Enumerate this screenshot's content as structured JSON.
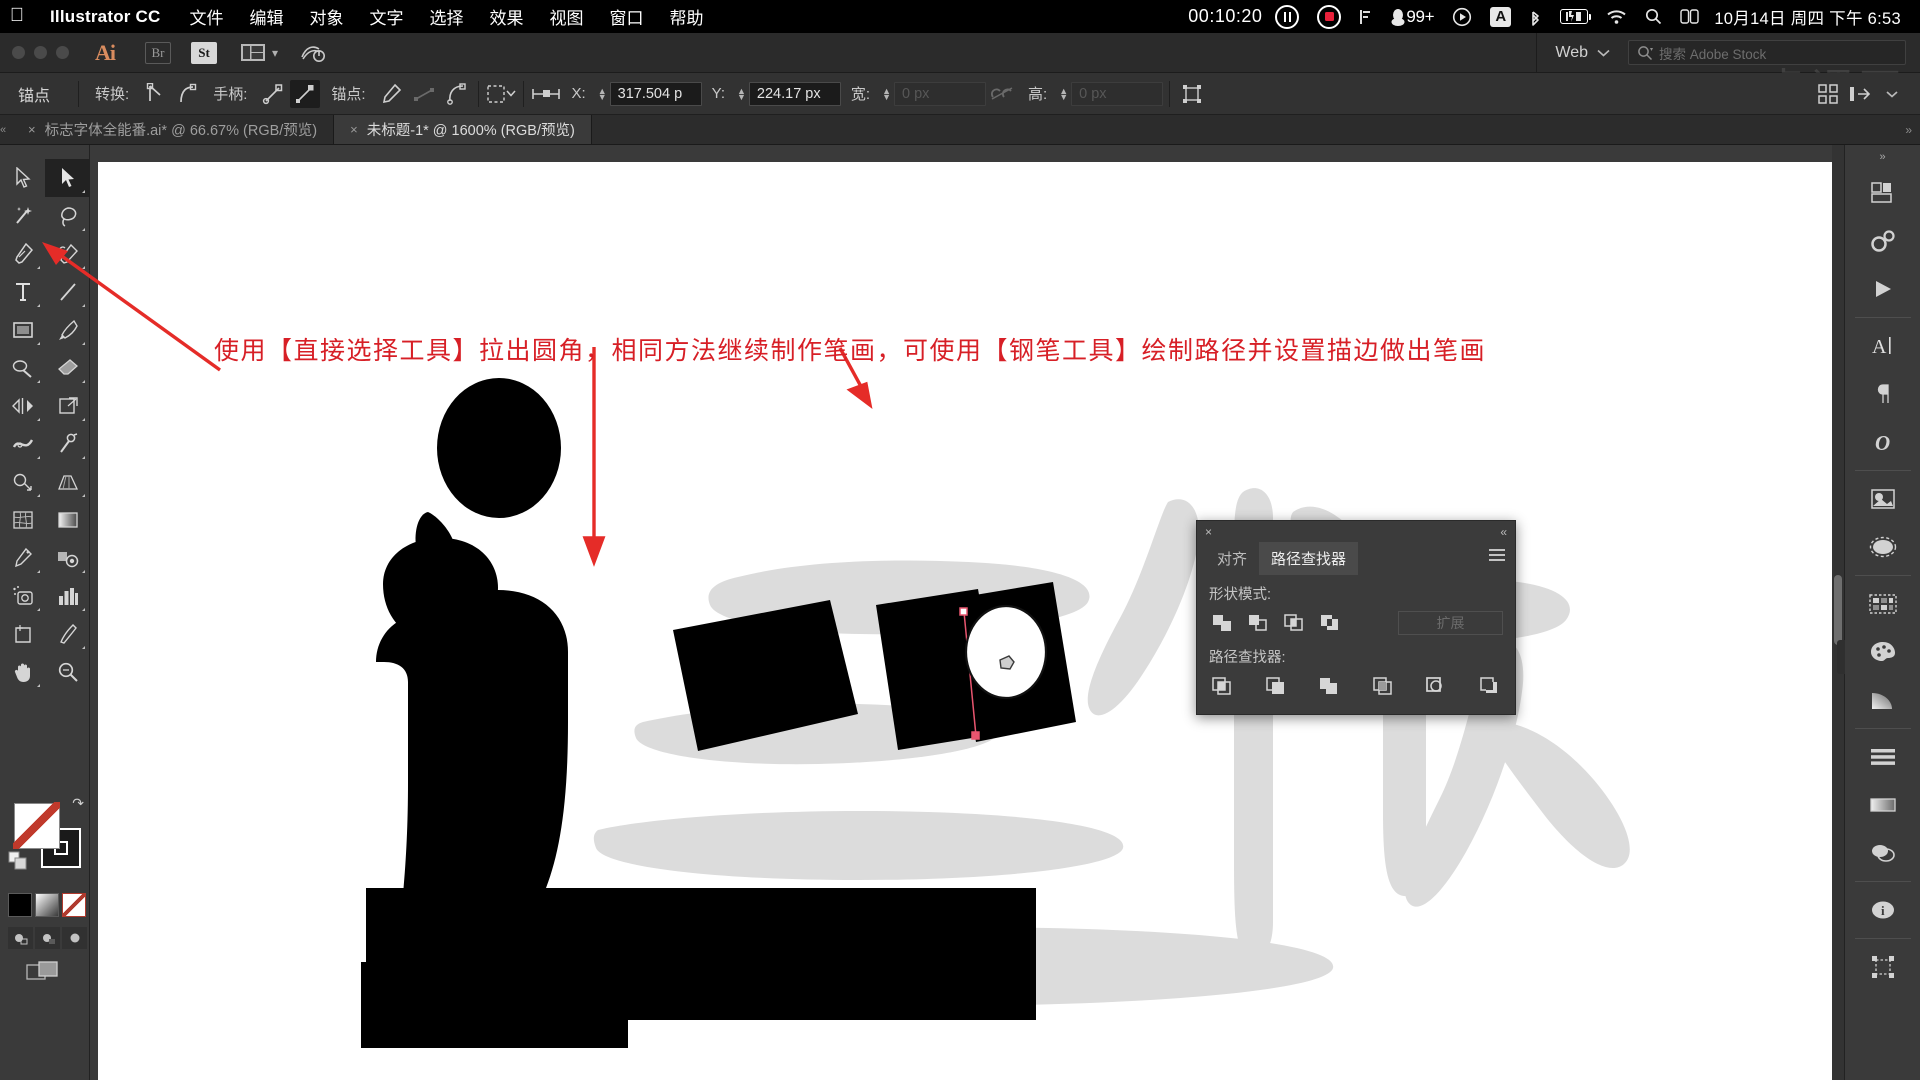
{
  "mac_menu": {
    "apple_icon": "apple-icon",
    "app_name": "Illustrator CC",
    "items": [
      "文件",
      "编辑",
      "对象",
      "文字",
      "选择",
      "效果",
      "视图",
      "窗口",
      "帮助"
    ],
    "recording_time": "00:10:20",
    "notification_badge": "99+",
    "input_source": "A",
    "datetime": "10月14日 周四 下午 6:53",
    "status_icons": [
      "pause-icon",
      "record-icon",
      "signal-icon",
      "penguin-icon",
      "play-circle-icon",
      "input-source-icon",
      "bluetooth-icon",
      "battery-icon",
      "wifi-icon",
      "search-icon",
      "control-center-icon"
    ]
  },
  "appbar": {
    "logo": "Ai",
    "buttons": [
      {
        "label": "Br",
        "name": "bridge-button",
        "active": false
      },
      {
        "label": "St",
        "name": "stock-button",
        "active": true
      }
    ],
    "arrange_icon": "arrange-documents-icon",
    "chevron": "▾",
    "sync_icon": "sync-settings-icon",
    "workspace": "Web",
    "search_placeholder": "搜索 Adobe Stock",
    "watermark": "虎课网"
  },
  "control_bar": {
    "title": "锚点",
    "convert_label": "转换:",
    "handles_label": "手柄:",
    "anchor_label": "锚点:",
    "x_label": "X:",
    "x_value": "317.504 p",
    "y_label": "Y:",
    "y_value": "224.17 px",
    "w_label": "宽:",
    "w_value": "0 px",
    "h_label": "高:",
    "h_value": "0 px",
    "link_icon": "unlink-icon",
    "align_icon": "align-icon",
    "icons": [
      "convert-corner-icon",
      "convert-smooth-icon",
      "handle-show-icon",
      "handle-hide-icon",
      "anchor-remove-icon",
      "anchor-connect-icon",
      "anchor-cut-icon",
      "isolate-icon",
      "transform-icon"
    ],
    "right_icons": [
      "grid-view-icon",
      "arrange-icon",
      "more-icon"
    ]
  },
  "tabs": [
    {
      "label": "标志字体全能番.ai* @ 66.67% (RGB/预览)",
      "active": false,
      "close": "×"
    },
    {
      "label": "未标题-1* @ 1600% (RGB/预览)",
      "active": true,
      "close": "×"
    }
  ],
  "toolbar": {
    "tools": [
      {
        "name": "selection-tool",
        "icon": "selection-arrow-icon",
        "selected": false
      },
      {
        "name": "direct-selection-tool",
        "icon": "direct-selection-arrow-icon",
        "selected": true
      },
      {
        "name": "magic-wand-tool",
        "icon": "magic-wand-icon",
        "selected": false
      },
      {
        "name": "lasso-tool",
        "icon": "lasso-icon",
        "selected": false
      },
      {
        "name": "pen-tool",
        "icon": "pen-icon",
        "selected": false
      },
      {
        "name": "curvature-tool",
        "icon": "curvature-icon",
        "selected": false
      },
      {
        "name": "type-tool",
        "icon": "type-t-icon",
        "selected": false
      },
      {
        "name": "line-segment-tool",
        "icon": "line-segment-icon",
        "selected": false
      },
      {
        "name": "rectangle-tool",
        "icon": "rectangle-icon",
        "selected": false
      },
      {
        "name": "paintbrush-tool",
        "icon": "paintbrush-icon",
        "selected": false
      },
      {
        "name": "shaper-tool",
        "icon": "shaper-icon",
        "selected": false
      },
      {
        "name": "eraser-tool",
        "icon": "eraser-icon",
        "selected": false
      },
      {
        "name": "rotate-tool",
        "icon": "rotate-reflect-icon",
        "selected": false
      },
      {
        "name": "scale-tool",
        "icon": "scale-icon",
        "selected": false
      },
      {
        "name": "width-tool",
        "icon": "width-icon",
        "selected": false
      },
      {
        "name": "free-transform-tool",
        "icon": "pushpin-icon",
        "selected": false
      },
      {
        "name": "shape-builder-tool",
        "icon": "shape-builder-icon",
        "selected": false
      },
      {
        "name": "perspective-grid-tool",
        "icon": "perspective-grid-icon",
        "selected": false
      },
      {
        "name": "mesh-tool",
        "icon": "mesh-icon",
        "selected": false
      },
      {
        "name": "gradient-tool",
        "icon": "gradient-icon",
        "selected": false
      },
      {
        "name": "eyedropper-tool",
        "icon": "eyedropper-icon",
        "selected": false
      },
      {
        "name": "blend-tool",
        "icon": "blend-icon",
        "selected": false
      },
      {
        "name": "symbol-sprayer-tool",
        "icon": "symbol-sprayer-icon",
        "selected": false
      },
      {
        "name": "column-graph-tool",
        "icon": "bar-chart-icon",
        "selected": false
      },
      {
        "name": "artboard-tool",
        "icon": "artboard-icon",
        "selected": false
      },
      {
        "name": "slice-tool",
        "icon": "slice-knife-icon",
        "selected": false
      },
      {
        "name": "hand-tool",
        "icon": "hand-icon",
        "selected": false
      },
      {
        "name": "zoom-tool",
        "icon": "magnifier-icon",
        "selected": false
      }
    ],
    "fill_color": "#ffffff",
    "stroke_color": "#000000",
    "fill_none": true
  },
  "canvas": {
    "annotation": "使用【直接选择工具】拉出圆角，相同方法继续制作笔画，可使用【钢笔工具】绘制路径并设置描边做出笔画",
    "annotation_color": "#d71f26",
    "artwork_background": "#ffffff",
    "guide_shape_color": "#dcdcdc",
    "shape_color": "#000000"
  },
  "pathfinder": {
    "close_icon": "×",
    "collapse_icon": "«",
    "menu_icon": "panel-menu-icon",
    "tabs": [
      {
        "label": "对齐",
        "active": false
      },
      {
        "label": "路径查找器",
        "active": true
      }
    ],
    "shape_modes_label": "形状模式:",
    "shape_mode_buttons": [
      "unite-icon",
      "minus-front-icon",
      "intersect-icon",
      "exclude-icon"
    ],
    "expand_label": "扩展",
    "pathfinders_label": "路径查找器:",
    "pathfinder_buttons": [
      "divide-icon",
      "trim-icon",
      "merge-icon",
      "crop-icon",
      "outline-icon",
      "minus-back-icon"
    ]
  },
  "right_dock": {
    "collapse_icon": "«",
    "items": [
      {
        "name": "panel-properties",
        "icon": "properties-icon"
      },
      {
        "name": "panel-actions",
        "icon": "gears-icon"
      },
      {
        "name": "panel-play",
        "icon": "play-triangle-icon"
      },
      {
        "name": "panel-character",
        "icon": "character-A-icon"
      },
      {
        "name": "panel-paragraph",
        "icon": "paragraph-pilcrow-icon"
      },
      {
        "name": "panel-opentype",
        "icon": "opentype-O-icon"
      },
      {
        "name": "panel-image-trace",
        "icon": "image-trace-icon"
      },
      {
        "name": "panel-brushes",
        "icon": "brushes-ellipse-icon"
      },
      {
        "name": "panel-swatches",
        "icon": "swatches-icon"
      },
      {
        "name": "panel-color",
        "icon": "color-palette-icon"
      },
      {
        "name": "panel-gradient",
        "icon": "gradient-quarter-icon"
      },
      {
        "name": "panel-align",
        "icon": "align-lines-icon"
      },
      {
        "name": "panel-stroke",
        "icon": "stroke-bar-icon"
      },
      {
        "name": "panel-transparency",
        "icon": "transparency-circles-icon"
      },
      {
        "name": "panel-info",
        "icon": "info-i-icon"
      },
      {
        "name": "panel-transform",
        "icon": "transform-box-icon"
      }
    ]
  }
}
